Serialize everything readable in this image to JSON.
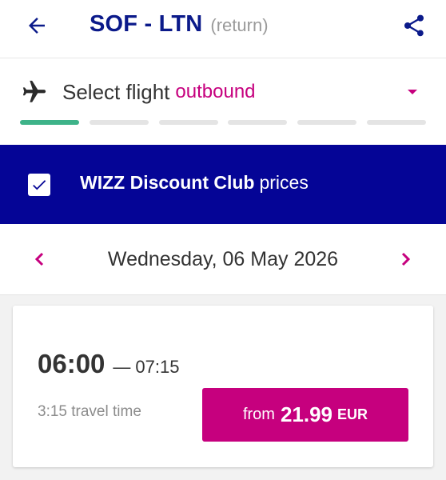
{
  "header": {
    "route": "SOF - LTN",
    "trip_type": "(return)",
    "back_icon": "arrow-left-icon",
    "share_icon": "share-icon"
  },
  "flight_step": {
    "label": "Select flight",
    "highlight": "outbound",
    "icon": "airplane-icon",
    "dropdown_icon": "caret-down-icon",
    "progress_total_steps": 6,
    "progress_current_step": 1
  },
  "discount_club": {
    "checked": true,
    "label_bold": "WIZZ Discount Club",
    "label_normal": "prices"
  },
  "date_nav": {
    "date": "Wednesday, 06 May 2026",
    "prev_icon": "chevron-left-icon",
    "next_icon": "chevron-right-icon"
  },
  "flight": {
    "departure": "06:00",
    "separator": "—",
    "arrival": "07:15",
    "travel_time": "3:15 travel time",
    "price_prefix": "from",
    "price": "21.99",
    "currency": "EUR"
  },
  "colors": {
    "brand_navy": "#050596",
    "route_navy": "#0b1a8a",
    "brand_magenta": "#c6007e",
    "progress_green": "#3eb389"
  }
}
